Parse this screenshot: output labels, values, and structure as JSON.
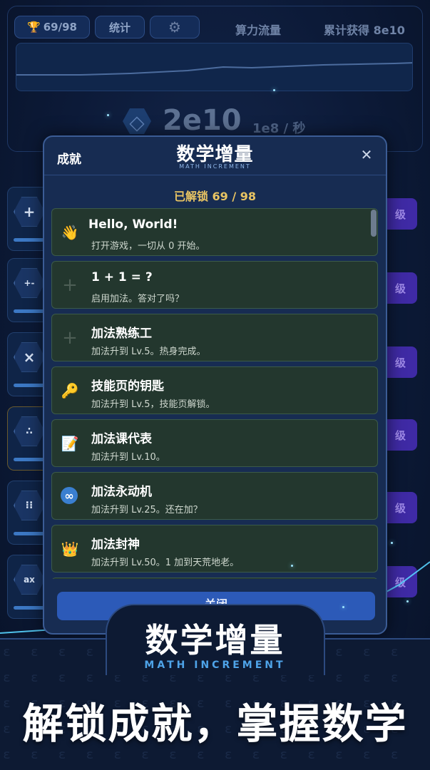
{
  "topbar": {
    "trophy_icon": "trophy-icon",
    "achievements_count": "69/98",
    "stats_label": "统计",
    "settings_icon": "gear-icon",
    "flow_label": "算力流量",
    "total_label": "累计获得",
    "total_value": "8e10"
  },
  "main": {
    "value": "2e10",
    "rate": "1e8 / 秒"
  },
  "side": {
    "button_fragment": "级"
  },
  "modal": {
    "title": "成就",
    "logo_cn": "数学增量",
    "logo_en": "MATH INCREMENT",
    "unlocked_label": "已解锁",
    "unlocked_value": "69 / 98",
    "close_button": "关闭",
    "achievements": [
      {
        "icon": "waving-hand-icon",
        "glyph": "👋",
        "title": "Hello, World!",
        "desc": "打开游戏，一切从 0 开始。"
      },
      {
        "icon": "plus-icon",
        "glyph": "+",
        "title": "1 + 1 = ?",
        "desc": "启用加法。答对了吗？"
      },
      {
        "icon": "plus-icon",
        "glyph": "+",
        "title": "加法熟练工",
        "desc": "加法升到 Lv.5。热身完成。"
      },
      {
        "icon": "key-icon",
        "glyph": "🔑",
        "title": "技能页的钥匙",
        "desc": "加法升到 Lv.5，技能页解锁。"
      },
      {
        "icon": "memo-icon",
        "glyph": "📝",
        "title": "加法课代表",
        "desc": "加法升到 Lv.10。"
      },
      {
        "icon": "infinity-icon",
        "glyph": "∞",
        "title": "加法永动机",
        "desc": "加法升到 Lv.25。还在加？"
      },
      {
        "icon": "crown-icon",
        "glyph": "👑",
        "title": "加法封神",
        "desc": "加法升到 Lv.50。1 加到天荒地老。"
      }
    ]
  },
  "promo": {
    "logo_cn": "数学增量",
    "logo_en": "MATH INCREMENT",
    "slogan": "解锁成就，掌握数学"
  },
  "colors": {
    "accent_gold": "#e8c463",
    "card_bg": "#23372e",
    "button_blue": "#2c5ab8",
    "purple_button": "#3f2aa5"
  }
}
